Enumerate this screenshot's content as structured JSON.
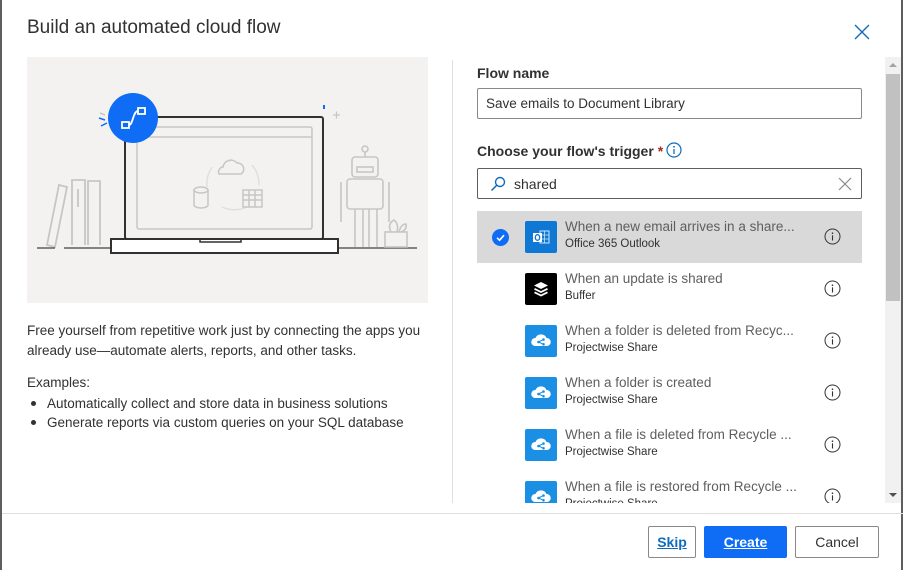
{
  "dialog": {
    "title": "Build an automated cloud flow",
    "close_icon": "close-icon"
  },
  "left": {
    "illustration": "laptop-flow-illustration",
    "description": "Free yourself from repetitive work just by connecting the apps you already use—automate alerts, reports, and other tasks.",
    "examples_label": "Examples:",
    "examples": [
      "Automatically collect and store data in business solutions",
      "Generate reports via custom queries on your SQL database"
    ]
  },
  "form": {
    "flow_name_label": "Flow name",
    "flow_name_value": "Save emails to Document Library",
    "trigger_label": "Choose your flow's trigger",
    "required_marker": "*",
    "search_value": "shared"
  },
  "triggers": [
    {
      "title": "When a new email arrives in a share...",
      "connector": "Office 365 Outlook",
      "icon": "outlook-icon",
      "icon_bg": "#0f78d4",
      "selected": true
    },
    {
      "title": "When an update is shared",
      "connector": "Buffer",
      "icon": "buffer-icon",
      "icon_bg": "#000000",
      "selected": false
    },
    {
      "title": "When a folder is deleted from Recyc...",
      "connector": "Projectwise Share",
      "icon": "projectwise-share-icon",
      "icon_bg": "#1a8fe3",
      "selected": false
    },
    {
      "title": "When a folder is created",
      "connector": "Projectwise Share",
      "icon": "projectwise-share-icon",
      "icon_bg": "#1a8fe3",
      "selected": false
    },
    {
      "title": "When a file is deleted from Recycle ...",
      "connector": "Projectwise Share",
      "icon": "projectwise-share-icon",
      "icon_bg": "#1a8fe3",
      "selected": false
    },
    {
      "title": "When a file is restored from Recycle ...",
      "connector": "Projectwise Share",
      "icon": "projectwise-share-icon",
      "icon_bg": "#1a8fe3",
      "selected": false
    }
  ],
  "footer": {
    "skip_label": "Skip",
    "create_label": "Create",
    "cancel_label": "Cancel"
  },
  "colors": {
    "accent": "#0f6cf5",
    "selected_row": "#d9d9d9",
    "illustration_bg": "#f3f2f1"
  }
}
